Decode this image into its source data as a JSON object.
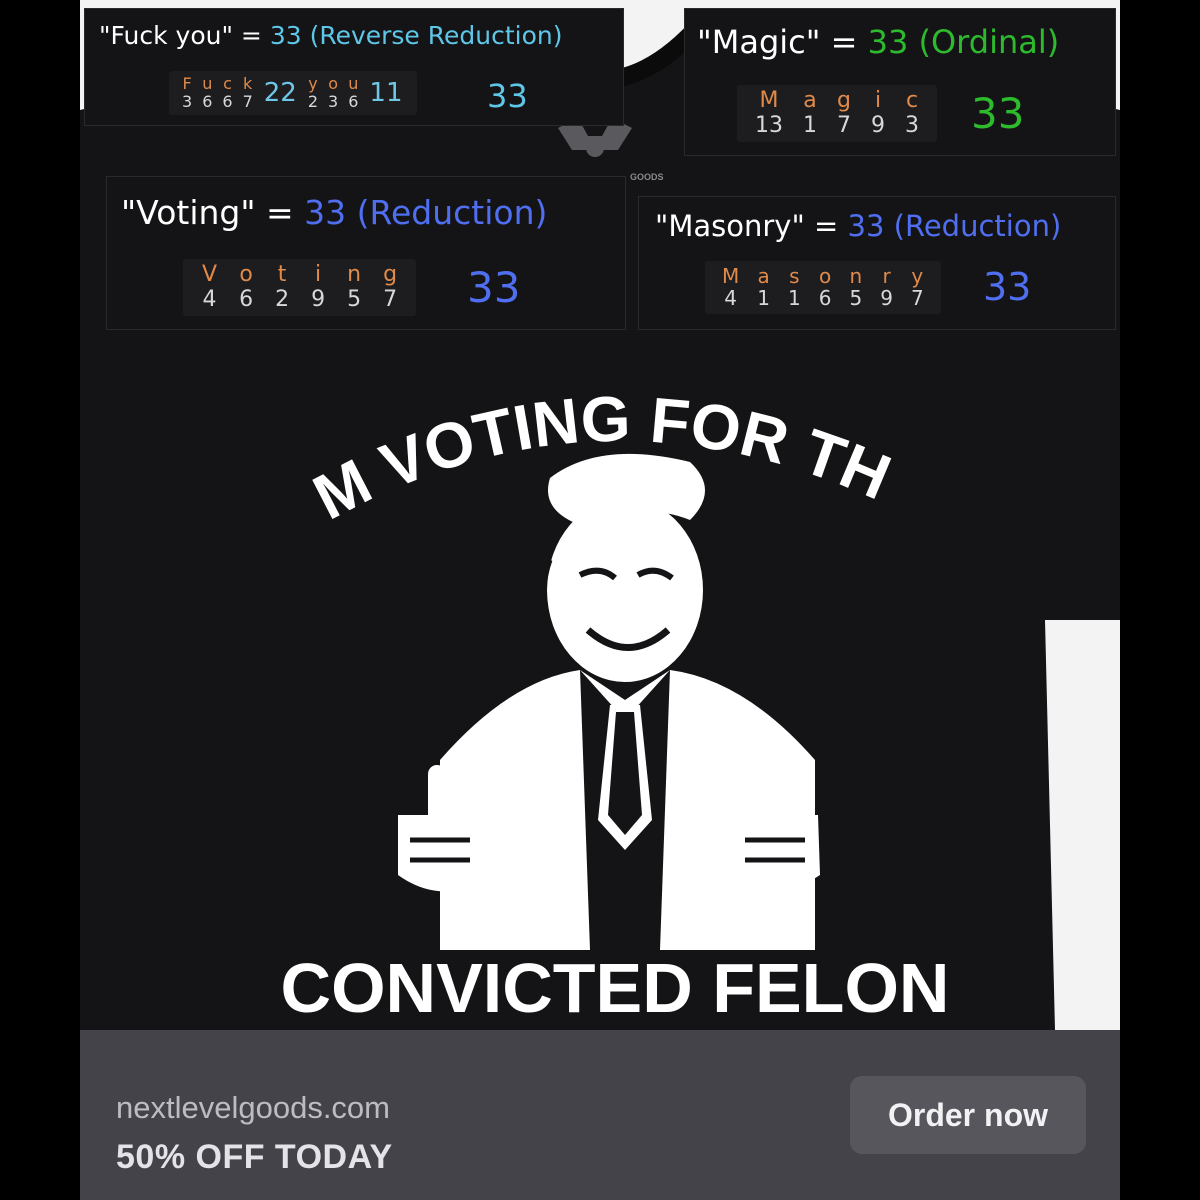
{
  "panels": {
    "fuck_you": {
      "word": "\"Fuck you\"",
      "equals": " = ",
      "result": "33 (Reverse Reduction)",
      "result_color": "#5ec6e6",
      "groups": [
        {
          "letters": [
            "F",
            "u",
            "c",
            "k"
          ],
          "values": [
            "3",
            "6",
            "6",
            "7"
          ],
          "subtotal": "22"
        },
        {
          "letters": [
            "y",
            "o",
            "u"
          ],
          "values": [
            "2",
            "3",
            "6"
          ],
          "subtotal": "11"
        }
      ],
      "total": "33"
    },
    "magic": {
      "word": "\"Magic\"",
      "equals": " = ",
      "result": "33 (Ordinal)",
      "result_color": "#2dbb2d",
      "letters": [
        "M",
        "a",
        "g",
        "i",
        "c"
      ],
      "values": [
        "13",
        "1",
        "7",
        "9",
        "3"
      ],
      "total": "33"
    },
    "voting": {
      "word": "\"Voting\"",
      "equals": " = ",
      "result": "33 (Reduction)",
      "result_color": "#4f6ff0",
      "letters": [
        "V",
        "o",
        "t",
        "i",
        "n",
        "g"
      ],
      "values": [
        "4",
        "6",
        "2",
        "9",
        "5",
        "7"
      ],
      "total": "33"
    },
    "masonry": {
      "word": "\"Masonry\"",
      "equals": " = ",
      "result": "33 (Reduction)",
      "result_color": "#4f6ff0",
      "letters": [
        "M",
        "a",
        "s",
        "o",
        "n",
        "r",
        "y"
      ],
      "values": [
        "4",
        "1",
        "1",
        "6",
        "5",
        "9",
        "7"
      ],
      "total": "33"
    }
  },
  "shirt": {
    "top_text": "I'M VOTING FOR THE",
    "bottom_text": "CONVICTED FELON",
    "tag_text": "GOODS"
  },
  "ad": {
    "domain": "nextlevelgoods.com",
    "offer": "50% OFF TODAY",
    "cta": "Order now"
  },
  "colors": {
    "letter": "#e08a4a",
    "value": "#d8d8d8",
    "subtotal": "#6fc7e8",
    "ad_bar": "#444349",
    "button": "#57565c",
    "shirt": "#141416"
  },
  "icons": {
    "brand_logo": "eagle-icon"
  }
}
